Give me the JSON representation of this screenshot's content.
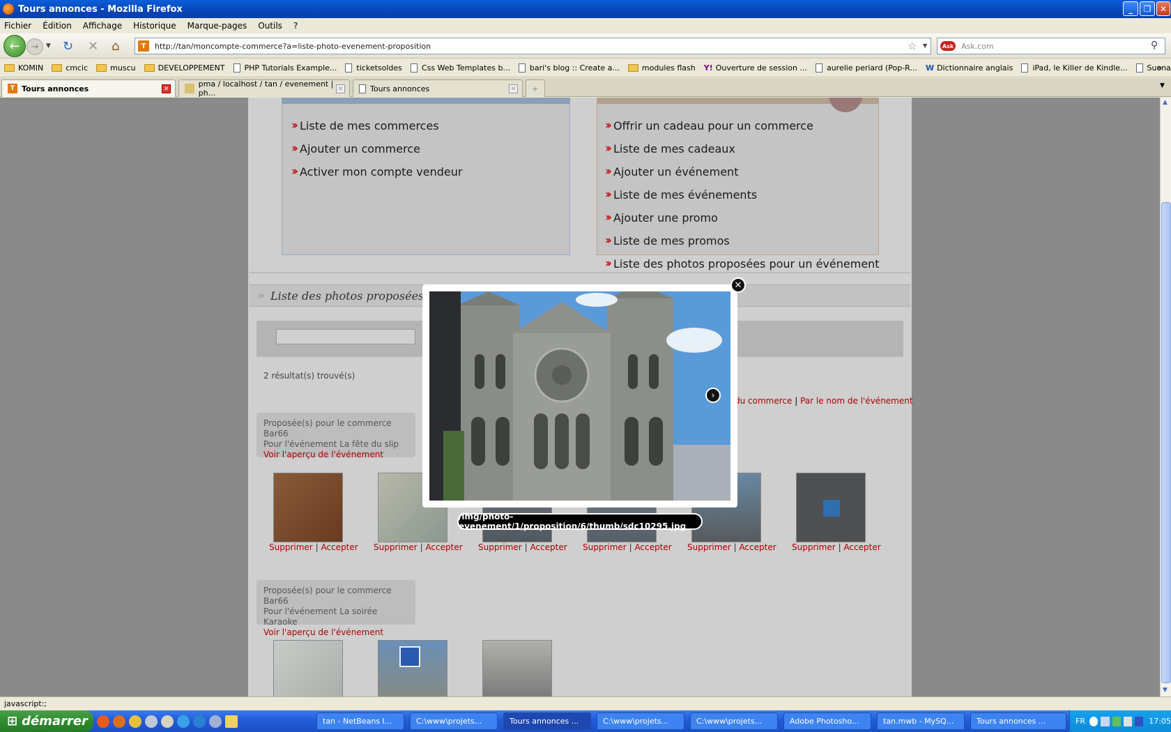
{
  "window": {
    "title": "Tours annonces - Mozilla Firefox"
  },
  "menu": [
    "Fichier",
    "Édition",
    "Affichage",
    "Historique",
    "Marque-pages",
    "Outils",
    "?"
  ],
  "nav": {
    "url": "http://tan/moncompte-commerce?a=liste-photo-evenement-proposition",
    "search_placeholder": "Ask.com"
  },
  "bookmarks": [
    {
      "label": "KOMIN",
      "icon": "folder"
    },
    {
      "label": "cmcic",
      "icon": "folder"
    },
    {
      "label": "muscu",
      "icon": "folder"
    },
    {
      "label": "DEVELOPPEMENT",
      "icon": "folder"
    },
    {
      "label": "PHP Tutorials Example...",
      "icon": "page"
    },
    {
      "label": "ticketsoldes",
      "icon": "page"
    },
    {
      "label": "Css Web Templates b...",
      "icon": "page"
    },
    {
      "label": "bari's blog :: Create a...",
      "icon": "page"
    },
    {
      "label": "modules flash",
      "icon": "folder"
    },
    {
      "label": "Ouverture de session ...",
      "icon": "yahoo"
    },
    {
      "label": "aurelie periard (Pop-R...",
      "icon": "page"
    },
    {
      "label": "Dictionnaire anglais",
      "icon": "wr"
    },
    {
      "label": "iPad, le Killer de Kindle...",
      "icon": "page"
    },
    {
      "label": "Suonare e Cantare su...",
      "icon": "page"
    }
  ],
  "tabs": [
    {
      "label": "Tours annonces"
    },
    {
      "label": "pma / localhost / tan / evenement | ph..."
    },
    {
      "label": "Tours annonces"
    }
  ],
  "page": {
    "base_links": [
      "Liste de mes commerces",
      "Ajouter un commerce",
      "Activer mon compte vendeur"
    ],
    "vendor_links": [
      "Offrir un cadeau pour un commerce",
      "Liste de mes cadeaux",
      "Ajouter un événement",
      "Liste de mes événements",
      "Ajouter une promo",
      "Liste de mes promos",
      "Liste des photos proposées pour un événement"
    ],
    "section_title": "Liste des photos proposées",
    "results": "2 résultat(s) trouvé(s)",
    "sort_links": {
      "a": "du commerce",
      "sep": "|",
      "b": "Par le nom de l'événement"
    },
    "group1": {
      "l1": "Proposée(s) pour le commerce Bar66",
      "l2": "Pour l'événement La fête du slip",
      "link": "Voir l'aperçu de l'événement"
    },
    "group2": {
      "l1": "Proposée(s) pour le commerce Bar66",
      "l2": "Pour l'événement La soirée Karaoke",
      "link": "Voir l'aperçu de l'événement"
    },
    "action_delete": "Supprimer",
    "action_sep": "|",
    "action_accept": "Accepter"
  },
  "lightbox": {
    "caption": "/img/photo-evenement/1/proposition/6/thumb/sdc10295.jpg"
  },
  "status": {
    "text": "javascript:;"
  },
  "taskbar": {
    "start": "démarrer",
    "items": [
      "tan - NetBeans I...",
      "C:\\www\\projets...",
      "Tours annonces ...",
      "C:\\www\\projets...",
      "C:\\www\\projets...",
      "Adobe Photosho...",
      "tan.mwb - MySQ...",
      "Tours annonces ..."
    ],
    "lang": "FR",
    "clock": "17:05"
  }
}
